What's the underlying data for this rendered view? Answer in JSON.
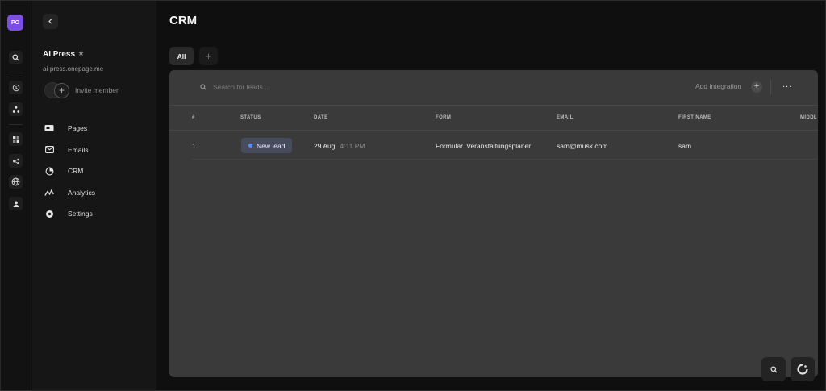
{
  "workspace": {
    "avatar_initials": "PO",
    "name": "AI Press",
    "url": "ai-press.onepage.me",
    "invite_label": "Invite member"
  },
  "sidebar": {
    "items": [
      {
        "label": "Pages",
        "icon": "pages-icon"
      },
      {
        "label": "Emails",
        "icon": "mail-icon"
      },
      {
        "label": "CRM",
        "icon": "crm-icon"
      },
      {
        "label": "Analytics",
        "icon": "analytics-icon"
      },
      {
        "label": "Settings",
        "icon": "settings-icon"
      }
    ]
  },
  "page": {
    "title": "CRM",
    "tabs": [
      {
        "label": "All"
      }
    ]
  },
  "toolbar": {
    "search_placeholder": "Search for leads...",
    "add_integration_label": "Add integration",
    "more_label": "..."
  },
  "table": {
    "columns": [
      "#",
      "STATUS",
      "DATE",
      "FORM",
      "EMAIL",
      "FIRST NAME",
      "MIDDL"
    ],
    "rows": [
      {
        "index": "1",
        "status": "New lead",
        "date": "29 Aug",
        "time": "4:11 PM",
        "form": "Formular. Veranstaltungsplaner",
        "email": "sam@musk.com",
        "first_name": "sam"
      }
    ]
  },
  "colors": {
    "avatar": "#7b4fe0",
    "panel": "#3a3a3a",
    "status_dot": "#5b8cff",
    "status_badge": "#474c5c"
  }
}
